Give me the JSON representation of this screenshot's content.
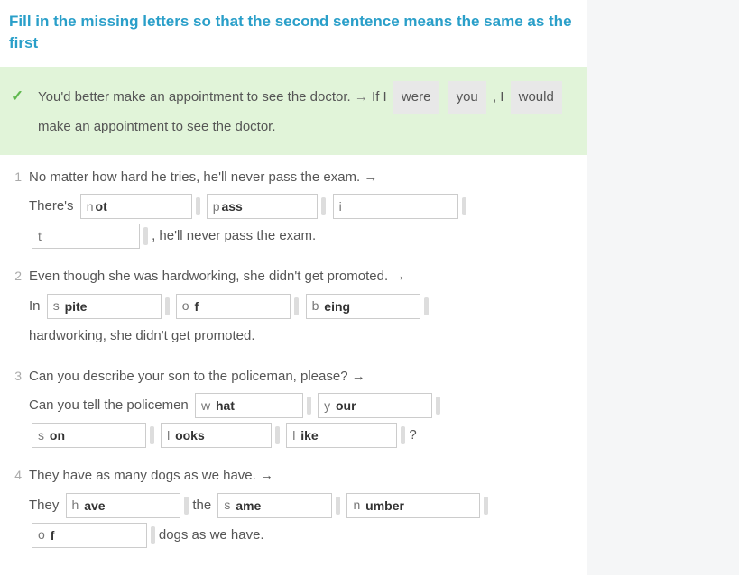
{
  "title": "Fill in the missing letters so that the second sentence means the same as the first",
  "example": {
    "part1": "You'd better make an appointment to see the doctor. ",
    "arrow": "→",
    "part2": " If I ",
    "fill1": "were",
    "gap1": " ",
    "fill2": "you",
    "part3": " , I ",
    "fill3": "would",
    "part4": " make an appointment to see the doctor."
  },
  "q1": {
    "num": "1",
    "prompt": "No matter how hard he tries, he'll never pass the exam. →",
    "line2a": "There's ",
    "b1_prefix": "n",
    "b1_value": "ot",
    "b2_prefix": "p",
    "b2_value": "ass",
    "b3_prefix": "i",
    "b3_value": "",
    "b4_prefix": "t",
    "b4_value": "",
    "line3b": ", he'll never pass the exam."
  },
  "q2": {
    "num": "2",
    "prompt": "Even though she was hardworking, she didn't get promoted. →",
    "line2a": "In ",
    "b1_prefix": "s ",
    "b1_value": "pite",
    "b2_prefix": "o ",
    "b2_value": "f",
    "b3_prefix": "b ",
    "b3_value": "eing",
    "line3": "hardworking, she didn't get promoted."
  },
  "q3": {
    "num": "3",
    "prompt": "Can you describe your son to the policeman, please? →",
    "line2a": "Can you tell the policemen ",
    "b1_prefix": "w ",
    "b1_value": "hat",
    "b2_prefix": "y ",
    "b2_value": "our",
    "b3_prefix": "s ",
    "b3_value": "on",
    "b4_prefix": "l ",
    "b4_value": "ooks",
    "b5_prefix": "l ",
    "b5_value": "ike",
    "tail": "?"
  },
  "q4": {
    "num": "4",
    "prompt": "They have as many dogs as we have. →",
    "line2a": "They ",
    "b1_prefix": "h ",
    "b1_value": "ave",
    "mid1": " the ",
    "b2_prefix": "s ",
    "b2_value": "ame",
    "b3_prefix": "n ",
    "b3_value": "umber",
    "b4_prefix": "o ",
    "b4_value": "f",
    "tail": " dogs as we have."
  }
}
